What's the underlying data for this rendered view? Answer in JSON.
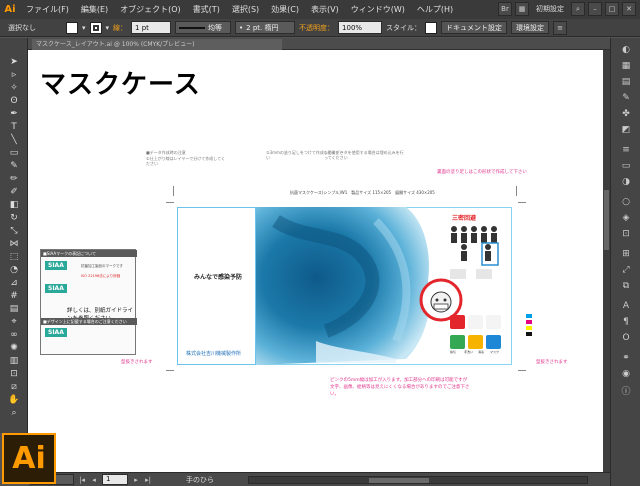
{
  "app": {
    "logo": "Ai",
    "workspace_label": "初期設定"
  },
  "menu": [
    "ファイル(F)",
    "編集(E)",
    "オブジェクト(O)",
    "書式(T)",
    "選択(S)",
    "効果(C)",
    "表示(V)",
    "ウィンドウ(W)",
    "ヘルプ(H)"
  ],
  "control": {
    "selection_label": "選択なし",
    "stroke_label": "線：",
    "stroke_weight": "1 pt",
    "profile_label": "均等",
    "brush_label": "2 pt. 楕円",
    "opacity_label": "不透明度：",
    "opacity_value": "100%",
    "style_label": "スタイル：",
    "doc_setup_button": "ドキュメント設定",
    "prefs_button": "環境設定"
  },
  "doc_tab": {
    "label": "マスクケース_レイアウト.ai @ 100% (CMYK/プレビュー)"
  },
  "artboard": {
    "title": "マスクケース",
    "notes_header": "■データ作成時の注意",
    "note_1": "①仕上がり線はレイヤーで分けて作成してください",
    "note_2": "②3mmの塗り足しをつけて作成してください",
    "note_3": "③画像データを使用する場合は埋め込みを行ってください",
    "size_line": "抗菌マスクケース(シンプル)W1　製品サイズ 115×205　展開サイズ 430×205",
    "pink_top": "裏面の塗り足しはこの形状で作成して下さい",
    "pink_left": "型抜きされます",
    "pink_right": "型抜きされます",
    "pink_bottom": "ピンクの5mm幅は加工が入ります。加工部分への印刷は可能ですが文字、画像、絵柄等は見えにくくなる場合がありますのでご注意下さい。",
    "slogan": "みんなで感染予防",
    "company": "株式会社吉川機械製作所",
    "sanmitsu": "三密回避",
    "icon_caps": [
      "換気",
      "手洗い",
      "消毒",
      "マスク"
    ],
    "infobox": {
      "hdr1": "■SIAAマークの表記について",
      "hdr2": "■デザイン上に記載する場合のご注意ください",
      "siaa": "SIAA",
      "bigtext": "詳しくは、別紙ガイドラインを参照ください",
      "line1": "抗菌加工製品のマークです",
      "line2": "ISO 22196法により評価"
    }
  },
  "status": {
    "zoom": "100%",
    "page": "1",
    "tool": "手のひら"
  },
  "colors": {
    "accent": "#ff9a00",
    "pink": "#e0358c",
    "blue": "#1d6fb8"
  }
}
